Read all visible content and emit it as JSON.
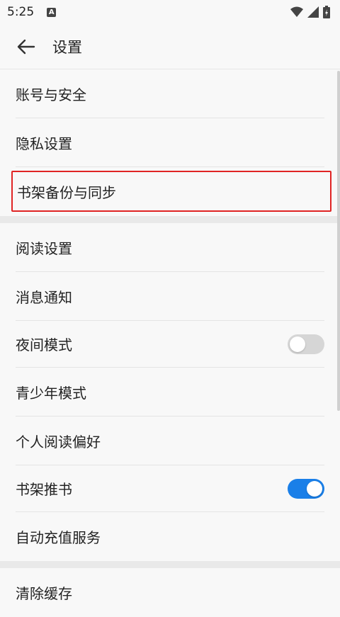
{
  "status": {
    "time": "5:25",
    "notif_letter": "A"
  },
  "header": {
    "title": "设置"
  },
  "groups": [
    {
      "items": [
        {
          "label": "账号与安全"
        },
        {
          "label": "隐私设置"
        },
        {
          "label": "书架备份与同步"
        }
      ]
    },
    {
      "items": [
        {
          "label": "阅读设置"
        },
        {
          "label": "消息通知"
        },
        {
          "label": "夜间模式",
          "toggle": false
        },
        {
          "label": "青少年模式"
        },
        {
          "label": "个人阅读偏好"
        },
        {
          "label": "书架推书",
          "toggle": true
        },
        {
          "label": "自动充值服务"
        }
      ]
    },
    {
      "items": [
        {
          "label": "清除缓存"
        }
      ]
    }
  ],
  "colors": {
    "toggle_on": "#1a7fe8",
    "toggle_off": "#d6d6d6",
    "highlight_border": "#e02424"
  }
}
